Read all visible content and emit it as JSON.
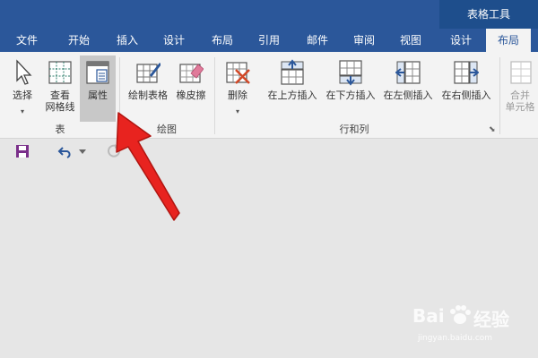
{
  "context_tab_title": "表格工具",
  "tabs": [
    {
      "label": "文件"
    },
    {
      "label": "开始"
    },
    {
      "label": "插入"
    },
    {
      "label": "设计"
    },
    {
      "label": "布局"
    },
    {
      "label": "引用"
    },
    {
      "label": "邮件"
    },
    {
      "label": "审阅"
    },
    {
      "label": "视图"
    },
    {
      "label": "设计"
    },
    {
      "label": "布局",
      "active": true
    }
  ],
  "ribbon": {
    "groups": [
      {
        "label": "表"
      },
      {
        "label": "绘图"
      },
      {
        "label": "行和列"
      }
    ],
    "buttons": {
      "select": "选择",
      "view_gridlines": "查看\n网格线",
      "properties": "属性",
      "draw_table": "绘制表格",
      "eraser": "橡皮擦",
      "delete": "删除",
      "insert_above": "在上方插入",
      "insert_below": "在下方插入",
      "insert_left": "在左侧插入",
      "insert_right": "在右侧插入",
      "merge_cells": "合并\n单元格"
    }
  },
  "colors": {
    "title_bar": "#2b579a",
    "ribbon": "#f3f3f3",
    "canvas": "#e6e6e6",
    "annotation_arrow": "#e8231f"
  },
  "watermark": {
    "brand": "Bai",
    "brand_cn": "经验",
    "url": "jingyan.baidu.com"
  }
}
